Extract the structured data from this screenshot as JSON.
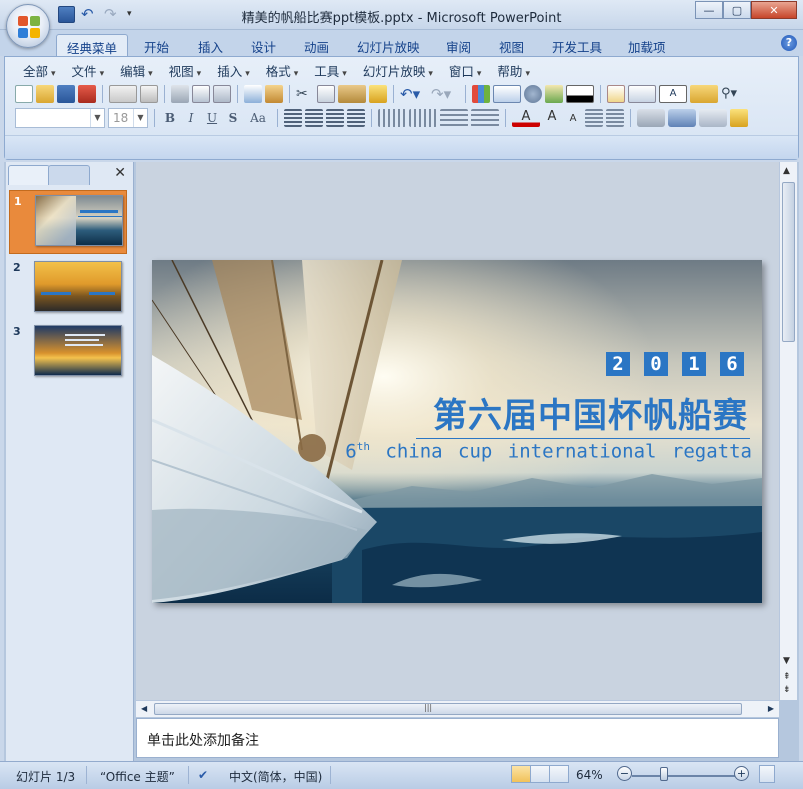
{
  "window": {
    "title": "精美的帆船比赛ppt模板.pptx - Microsoft PowerPoint",
    "controls": [
      "minimize",
      "maximize",
      "close"
    ]
  },
  "quick_access": [
    "save-icon",
    "undo-icon",
    "redo-icon",
    "customize-icon"
  ],
  "ribbon_tabs": [
    {
      "label": "经典菜单",
      "active": true
    },
    {
      "label": "开始"
    },
    {
      "label": "插入"
    },
    {
      "label": "设计"
    },
    {
      "label": "动画"
    },
    {
      "label": "幻灯片放映"
    },
    {
      "label": "审阅"
    },
    {
      "label": "视图"
    },
    {
      "label": "开发工具"
    },
    {
      "label": "加载项"
    }
  ],
  "menus": [
    "全部",
    "文件",
    "编辑",
    "视图",
    "插入",
    "格式",
    "工具",
    "幻灯片放映",
    "窗口",
    "帮助"
  ],
  "format_bar": {
    "font_name": "",
    "font_size": "18",
    "bold": "B",
    "italic": "I",
    "underline": "U",
    "strike": "S",
    "case": "Aa"
  },
  "thumbnails": [
    {
      "number": "1",
      "active": true
    },
    {
      "number": "2"
    },
    {
      "number": "3"
    }
  ],
  "slide": {
    "year_digits": [
      "2",
      "0",
      "1",
      "6"
    ],
    "title": "第六届中国杯帆船赛",
    "subtitle_prefix": "6",
    "subtitle_sup": "th",
    "subtitle_rest": " china cup international regatta",
    "accent_color": "#2b76c4"
  },
  "notes": {
    "placeholder": "单击此处添加备注"
  },
  "status": {
    "slide_counter": "幻灯片 1/3",
    "theme": "“Office 主题”",
    "language": "中文(简体，中国)",
    "zoom": "64%"
  }
}
